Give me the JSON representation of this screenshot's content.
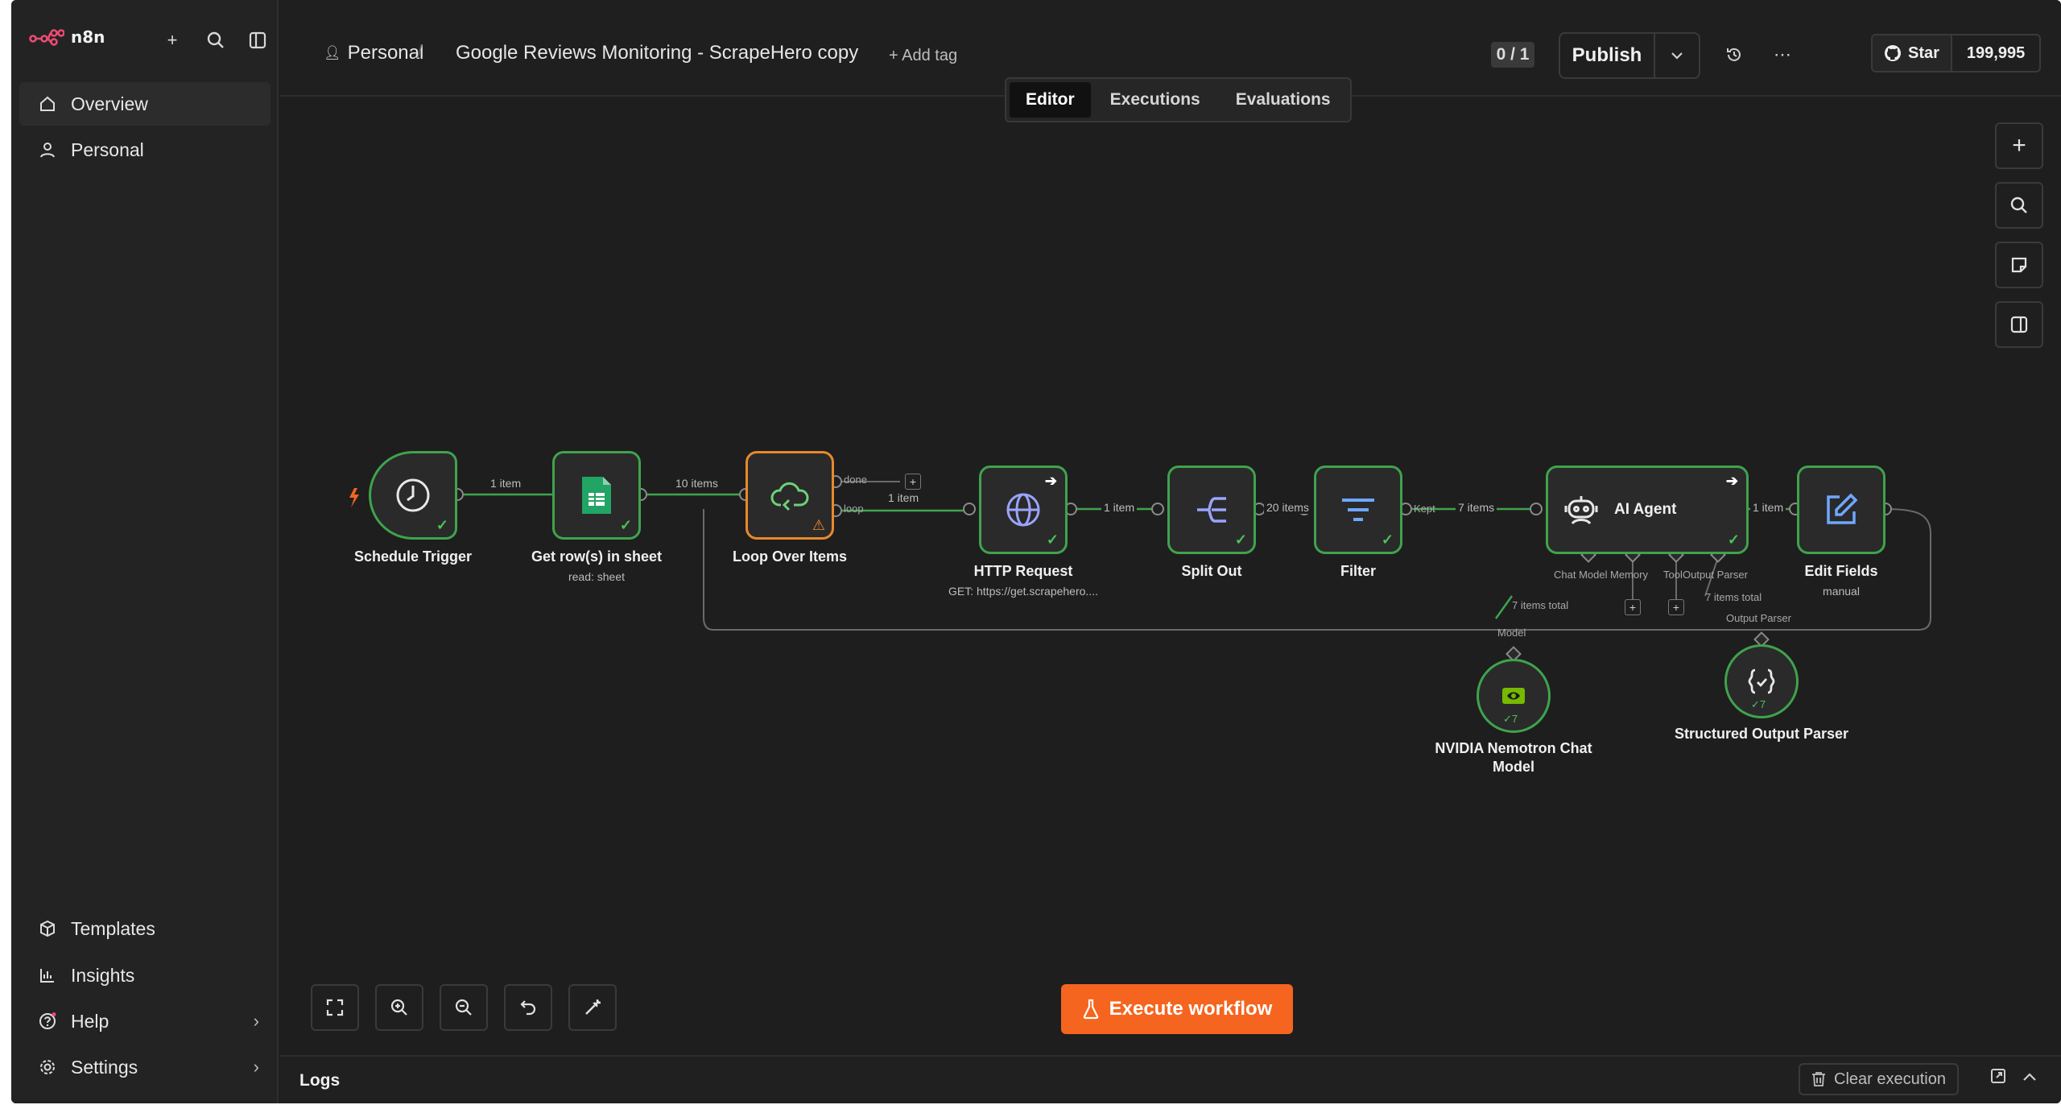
{
  "sidebar": {
    "brand": "n8n",
    "items_top": [
      {
        "label": "Overview",
        "icon": "home-icon"
      },
      {
        "label": "Personal",
        "icon": "user-icon"
      }
    ],
    "items_bottom": [
      {
        "label": "Templates",
        "icon": "templates-icon"
      },
      {
        "label": "Insights",
        "icon": "chart-icon"
      },
      {
        "label": "Help",
        "icon": "help-icon"
      },
      {
        "label": "Settings",
        "icon": "gear-icon"
      }
    ]
  },
  "header": {
    "project": "Personal",
    "workflow_name": "Google Reviews Monitoring - ScrapeHero copy",
    "add_tag": "+ Add tag",
    "version_count": "0 / 1",
    "publish_label": "Publish",
    "github_star": "Star",
    "github_count": "199,995"
  },
  "tabs": [
    "Editor",
    "Executions",
    "Evaluations"
  ],
  "nodes": {
    "schedule": {
      "title": "Schedule Trigger"
    },
    "sheet": {
      "title": "Get row(s) in sheet",
      "sub": "read: sheet"
    },
    "loop": {
      "title": "Loop Over Items"
    },
    "http": {
      "title": "HTTP Request",
      "sub": "GET: https://get.scrapehero...."
    },
    "split": {
      "title": "Split Out"
    },
    "filter": {
      "title": "Filter"
    },
    "agent": {
      "title": "AI Agent"
    },
    "edit": {
      "title": "Edit Fields",
      "sub": "manual"
    },
    "nvidia": {
      "title": "NVIDIA Nemotron Chat Model"
    },
    "parser": {
      "title": "Structured Output Parser"
    }
  },
  "edge_labels": {
    "e1": "1 item",
    "e2": "10 items",
    "done": "done",
    "loop": "loop",
    "e3": "1 item",
    "e4": "1 item",
    "e5": "20 items",
    "kept": "Kept",
    "e6": "7 items",
    "e7": "1 item",
    "chat_model": "Chat Model",
    "memory": "Memory",
    "tool": "Tool",
    "output_parser": "Output Parser",
    "items_total_a": "7 items total",
    "items_total_b": "7 items total",
    "model": "Model",
    "output_parser_2": "Output Parser",
    "nvidia_count": "7",
    "parser_count": "7"
  },
  "execute_label": "Execute workflow",
  "logs": {
    "label": "Logs",
    "clear_label": "Clear execution"
  },
  "colors": {
    "accent": "#f5651f",
    "success": "#3fa34d",
    "loop": "#e8892c",
    "background": "#1e1e1e"
  }
}
